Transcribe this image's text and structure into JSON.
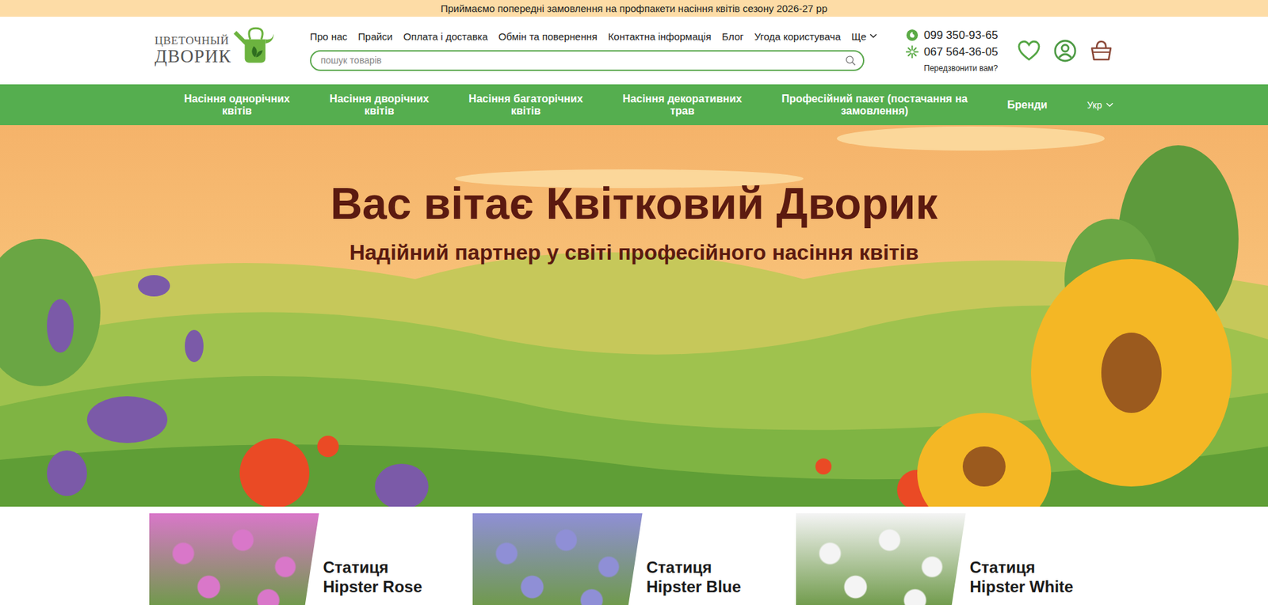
{
  "announcement": "Приймаємо попередні замовлення на профпакети насіння квітів сезону 2026-27 рр",
  "logo": {
    "line1": "ЦВЕТОЧНЫЙ",
    "line2": "ДВОРИК"
  },
  "top_nav": [
    {
      "label": "Про нас"
    },
    {
      "label": "Прайси"
    },
    {
      "label": "Оплата і доставка"
    },
    {
      "label": "Обмін та повернення"
    },
    {
      "label": "Контактна інформація"
    },
    {
      "label": "Блог"
    },
    {
      "label": "Угода користувача"
    }
  ],
  "more": {
    "label": "Ще"
  },
  "search": {
    "placeholder": "пошук товарів"
  },
  "phones": [
    {
      "number": "099 350-93-65",
      "kind": "vodafone"
    },
    {
      "number": "067 564-36-05",
      "kind": "kyivstar"
    }
  ],
  "callback": "Передзвонити вам?",
  "categories": [
    {
      "lines": [
        "Насіння однорічних",
        "квітів"
      ]
    },
    {
      "lines": [
        "Насіння дворічних",
        "квітів"
      ]
    },
    {
      "lines": [
        "Насіння багаторічних",
        "квітів"
      ]
    },
    {
      "lines": [
        "Насіння декоративних",
        "трав"
      ]
    },
    {
      "lines": [
        "Професійний пакет (постачання на",
        "замовлення)"
      ]
    },
    {
      "lines": [
        "Бренди"
      ]
    }
  ],
  "language": {
    "label": "Укр"
  },
  "hero": {
    "title": "Вас вітає Квітковий Дворик",
    "subtitle": "Надійний партнер у світі професійного насіння квітів"
  },
  "promos": [
    {
      "title": "Статиця",
      "subtitle": "Hipster Rose",
      "color": "#d977c9"
    },
    {
      "title": "Статиця",
      "subtitle": "Hipster Blue",
      "color": "#8f8fd6"
    },
    {
      "title": "Статиця",
      "subtitle": "Hipster White",
      "color": "#f4f4f4"
    }
  ]
}
